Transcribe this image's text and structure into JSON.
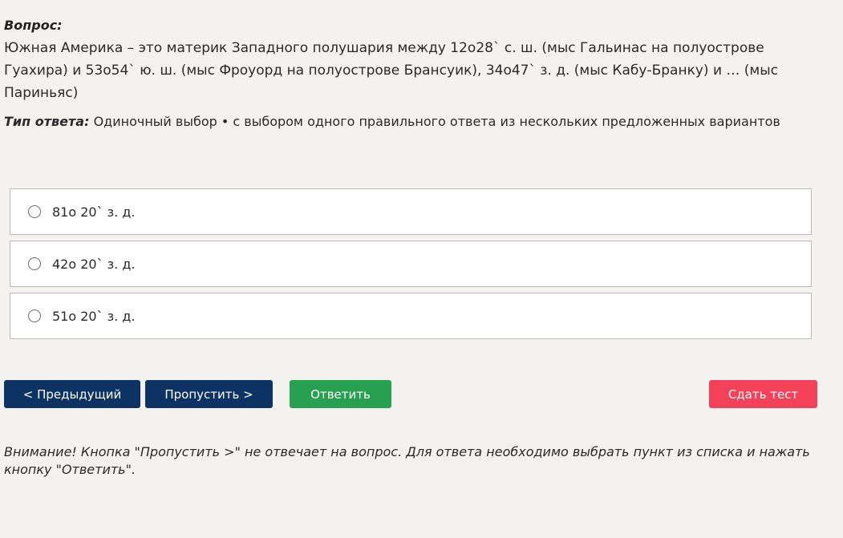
{
  "question": {
    "heading": "Вопрос:",
    "text": "Южная Америка – это материк Западного полушария между 12о28` с. ш. (мыс Гальинас на полуострове Гуахира) и 53о54` ю. ш. (мыс Фроуорд на полуострове Брансуик), 34о47` з. д. (мыс Кабу-Бранку) и … (мыс Париньяс)"
  },
  "answer_type": {
    "label": "Тип ответа:",
    "value": "Одиночный выбор • с выбором одного правильного ответа из нескольких предложенных вариантов"
  },
  "options": [
    {
      "label": "81о 20` з. д."
    },
    {
      "label": "42о 20` з. д."
    },
    {
      "label": "51о 20` з. д."
    }
  ],
  "buttons": {
    "prev": "< Предыдущий",
    "skip": "Пропустить >",
    "answer": "Ответить",
    "finish": "Сдать тест"
  },
  "warning": "Внимание! Кнопка \"Пропустить >\" не отвечает на вопрос. Для ответа необходимо выбрать пункт из списка и нажать кнопку \"Ответить\".",
  "colors": {
    "background": "#f3f2ef",
    "primary_button": "#0d3264",
    "answer_button": "#27a04f",
    "finish_button": "#f4415a"
  }
}
